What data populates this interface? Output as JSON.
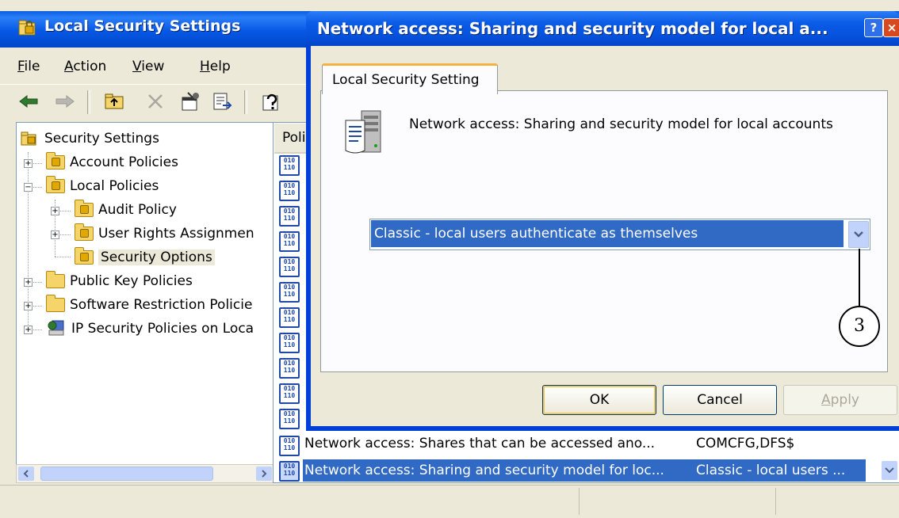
{
  "main_window": {
    "title": "Local Security Settings",
    "menu": [
      {
        "pre": "",
        "ul": "F",
        "post": "ile"
      },
      {
        "pre": "",
        "ul": "A",
        "post": "ction"
      },
      {
        "pre": "",
        "ul": "V",
        "post": "iew"
      },
      {
        "pre": "",
        "ul": "H",
        "post": "elp"
      }
    ],
    "toolbar_icons": [
      "back-arrow-icon",
      "forward-arrow-icon",
      "up-folder-icon",
      "delete-icon",
      "properties-icon",
      "export-list-icon",
      "help-icon"
    ]
  },
  "tree": {
    "items": [
      {
        "label": "Security Settings",
        "icon": "security-settings-icon"
      },
      {
        "label": "Account Policies",
        "icon": "locked-folder-icon"
      },
      {
        "label": "Local Policies",
        "icon": "locked-folder-icon"
      },
      {
        "label": "Audit Policy",
        "icon": "locked-folder-icon"
      },
      {
        "label": "User Rights Assignmen",
        "icon": "locked-folder-icon"
      },
      {
        "label": "Security Options",
        "icon": "locked-folder-icon",
        "selected": true
      },
      {
        "label": "Public Key Policies",
        "icon": "folder-icon"
      },
      {
        "label": "Software Restriction Policie",
        "icon": "folder-icon"
      },
      {
        "label": "IP Security Policies on Loca",
        "icon": "ip-security-icon"
      }
    ]
  },
  "list": {
    "column_header": "Poli",
    "rows": [
      {
        "policy": "Network access: Shares that can be accessed ano...",
        "setting": "COMCFG,DFS$"
      },
      {
        "policy": "Network access: Sharing and security model for loc...",
        "setting": "Classic - local users ..."
      }
    ]
  },
  "dialog": {
    "title": "Network access: Sharing and security model for local a...",
    "help_label": "?",
    "close_label": "×",
    "tab_label": "Local Security Setting",
    "description": "Network access: Sharing and security model for local accounts",
    "select_value": "Classic - local users authenticate as themselves",
    "ok_label": "OK",
    "cancel_label": "Cancel",
    "apply_ul": "A",
    "apply_rest": "pply"
  },
  "callout": {
    "number": "3"
  }
}
